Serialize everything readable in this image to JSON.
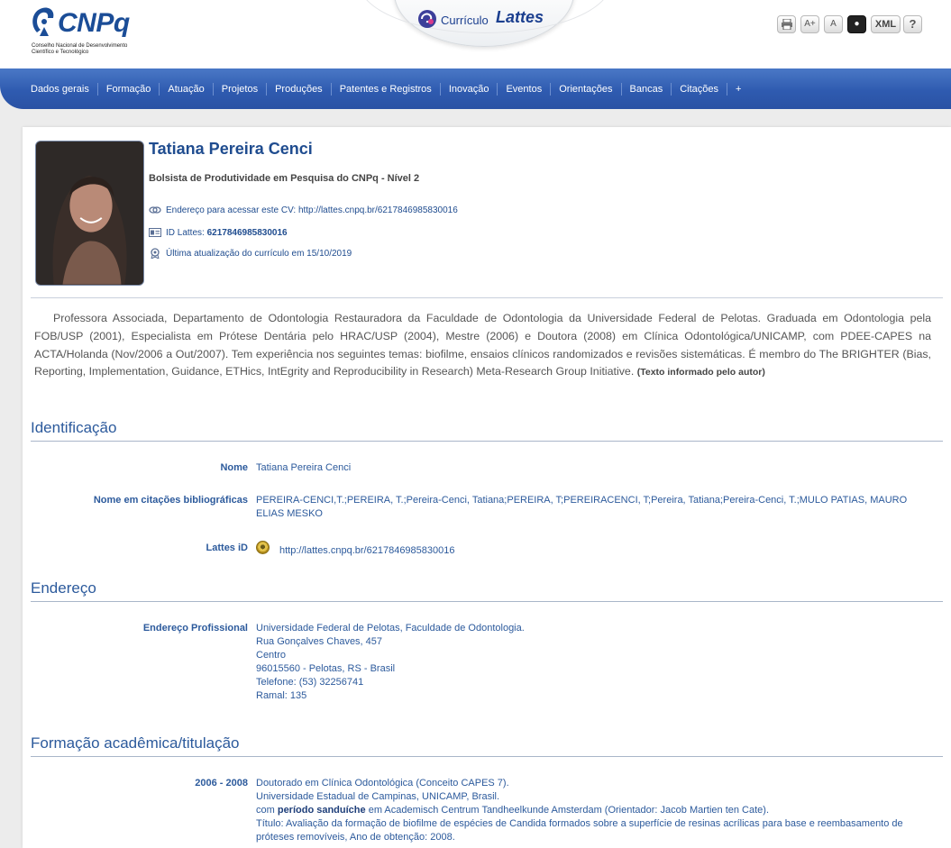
{
  "header": {
    "logo_word": "CNPq",
    "logo_subtitle": "Conselho Nacional de Desenvolvimento Científico e Tecnológico",
    "lattes_prefix": "Currículo",
    "lattes_word": "Lattes",
    "tools": [
      {
        "icon": "print-icon",
        "label": ""
      },
      {
        "icon": "font-increase-icon",
        "label": "A+"
      },
      {
        "icon": "font-reset-icon",
        "label": "A"
      },
      {
        "icon": "contrast-icon",
        "label": "●"
      },
      {
        "icon": "xml-icon",
        "label": "XML"
      },
      {
        "icon": "help-icon",
        "label": "?"
      }
    ]
  },
  "nav": {
    "items": [
      "Dados gerais",
      "Formação",
      "Atuação",
      "Projetos",
      "Produções",
      "Patentes e Registros",
      "Inovação",
      "Eventos",
      "Orientações",
      "Bancas",
      "Citações",
      "+"
    ]
  },
  "profile": {
    "name": "Tatiana Pereira Cenci",
    "fellowship": "Bolsista de Produtividade em Pesquisa do CNPq - Nível 2",
    "cv_address_label": "Endereço para acessar este CV:",
    "cv_address": "http://lattes.cnpq.br/6217846985830016",
    "id_label": "ID Lattes:",
    "id_value": "6217846985830016",
    "last_update": "Última atualização do currículo em 15/10/2019"
  },
  "abstract": {
    "text": "Professora Associada, Departamento de Odontologia Restauradora da Faculdade de Odontologia da Universidade Federal de Pelotas. Graduada em Odontologia pela FOB/USP (2001), Especialista em Prótese Dentária pelo HRAC/USP (2004), Mestre (2006) e Doutora (2008) em Clínica Odontológica/UNICAMP, com PDEE-CAPES na ACTA/Holanda (Nov/2006 a Out/2007). Tem experiência nos seguintes temas: biofilme, ensaios clínicos randomizados e revisões sistemáticas. É membro do The BRIGHTER (Bias, Reporting, Implementation, Guidance, ETHics, IntEgrity and Reproducibility in Research) Meta-Research Group Initiative.",
    "note": "(Texto informado pelo autor)"
  },
  "identificacao": {
    "title": "Identificação",
    "name_label": "Nome",
    "name_value": "Tatiana Pereira Cenci",
    "citations_label": "Nome em citações bibliográficas",
    "citations_value": "PEREIRA-CENCI,T.;PEREIRA, T.;Pereira-Cenci, Tatiana;PEREIRA, T;PEREIRACENCI, T;Pereira, Tatiana;Pereira-Cenci, T.;MULO PATIAS, MAURO ELIAS MESKO",
    "lattes_id_label": "Lattes iD",
    "lattes_id_value": "http://lattes.cnpq.br/6217846985830016"
  },
  "endereco": {
    "title": "Endereço",
    "label": "Endereço Profissional",
    "lines": [
      "Universidade Federal de Pelotas, Faculdade de Odontologia.",
      "Rua Gonçalves Chaves, 457",
      "Centro",
      "96015560 - Pelotas, RS - Brasil",
      "Telefone: (53) 32256741",
      "Ramal: 135"
    ]
  },
  "formacao": {
    "title": "Formação acadêmica/titulação",
    "entries": [
      {
        "period": "2006 - 2008",
        "course": "Doutorado em Clínica Odontológica",
        "course_note": "(Conceito CAPES 7).",
        "institution": "Universidade Estadual de Campinas, UNICAMP, Brasil.",
        "sandwich_prefix": "com",
        "sandwich_bold": "período sanduíche",
        "sandwich_suffix": "em Academisch Centrum Tandheelkunde Amsterdam (Orientador: Jacob Martien ten Cate).",
        "thesis": "Título: Avaliação da formação de biofilme de espécies de Candida formados sobre a superfície de resinas acrílicas para base e reembasamento de próteses removíveis, Ano de obtenção: 2008."
      }
    ]
  }
}
